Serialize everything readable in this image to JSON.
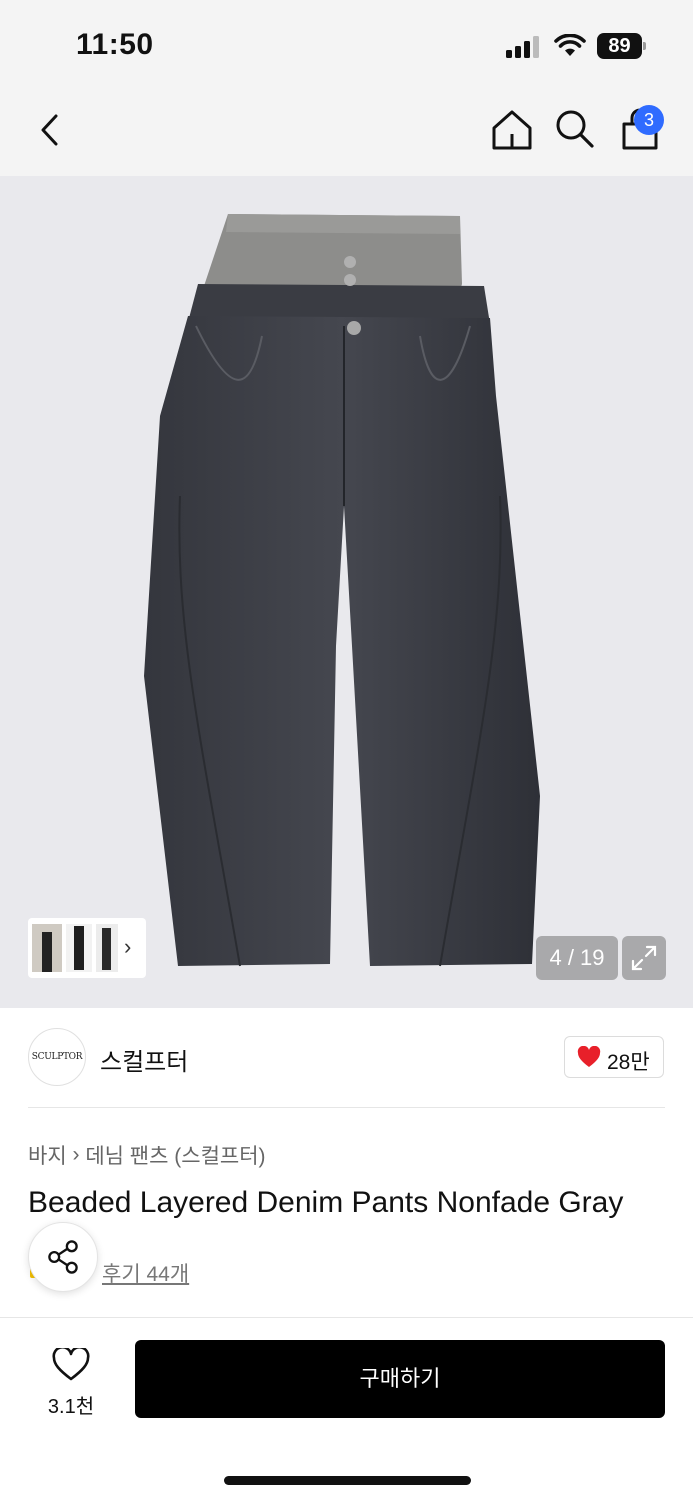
{
  "status_bar": {
    "time": "11:50",
    "battery": "89"
  },
  "nav": {
    "cart_badge": "3",
    "icons": [
      "back-icon",
      "home-icon",
      "search-icon",
      "shopping-bag-icon"
    ]
  },
  "gallery": {
    "counter": "4 / 19",
    "thumb_arrow": "›",
    "icons": [
      "expand-icon"
    ]
  },
  "brand": {
    "logo_text": "SCULPTOR",
    "name": "스컬프터",
    "likes": "28만"
  },
  "breadcrumb": {
    "category": "바지",
    "separator": "›",
    "subcategory": "데님 팬츠 (스컬프터)"
  },
  "product": {
    "title": "Beaded Layered Denim Pants Nonfade Gray",
    "reviews": "후기 44개"
  },
  "bottom": {
    "wish_count": "3.1천",
    "buy_label": "구매하기"
  },
  "colors": {
    "badge": "#2f6bff",
    "heart": "#e8202a",
    "buy_button": "#000000",
    "gallery_bg": "#e9e9ed"
  }
}
